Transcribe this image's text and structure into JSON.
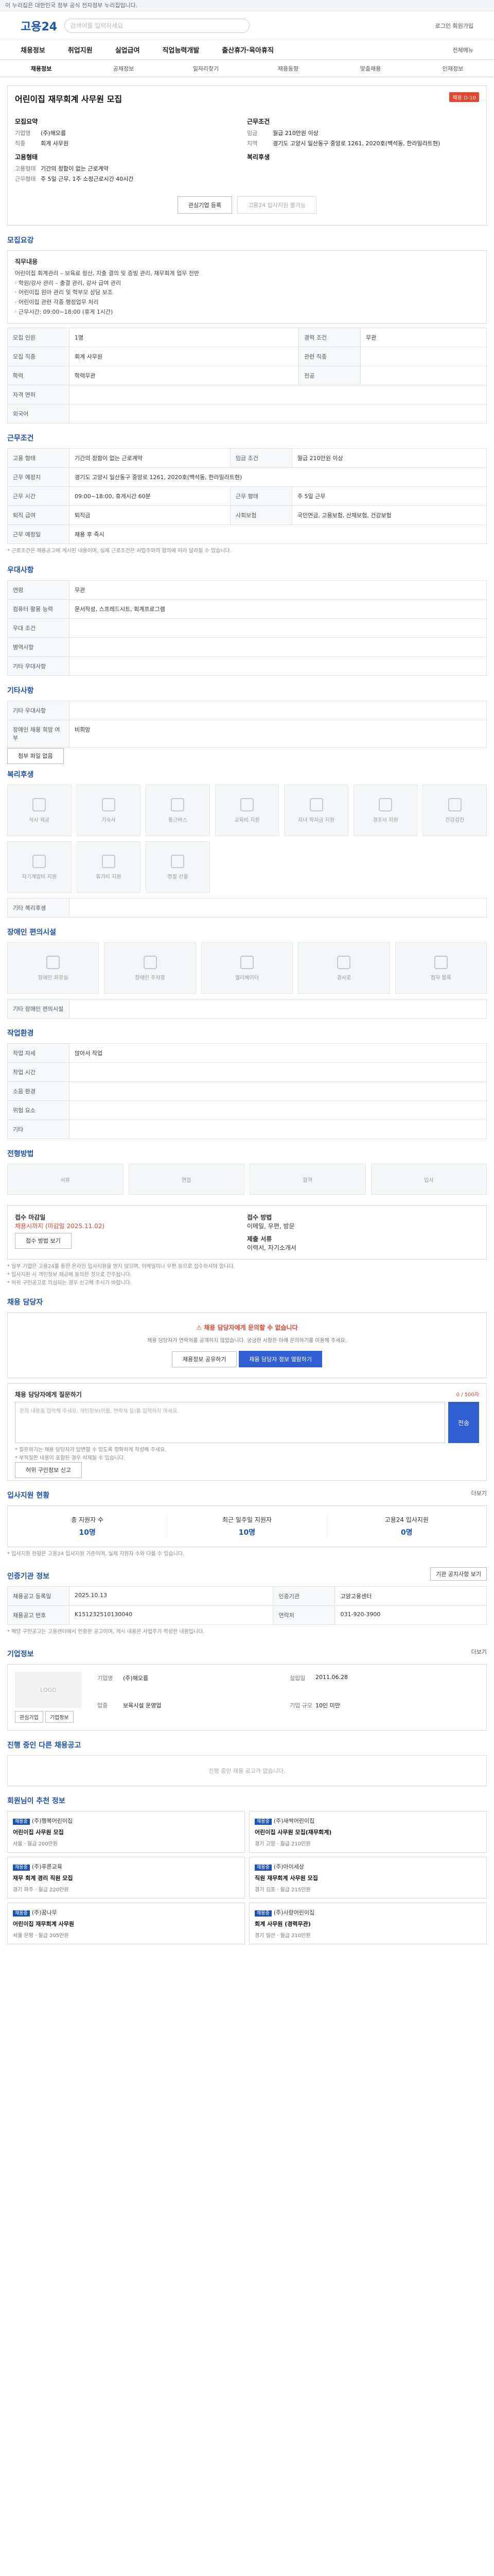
{
  "topbar": {
    "text": "이 누리집은 대한민국 정부 공식 전자정부 누리집입니다."
  },
  "header": {
    "logo": "고용24",
    "search_placeholder": "검색어를 입력하세요",
    "right_links": "로그인 회원가입"
  },
  "mainnav": [
    "채용정보",
    "취업지원",
    "실업급여",
    "직업능력개발",
    "출산휴가·육아휴직"
  ],
  "mainnav_right": "전체메뉴",
  "subnav": [
    "채용정보",
    "공채정보",
    "일자리찾기",
    "채용동향",
    "맞춤채용",
    "인재정보"
  ],
  "job": {
    "title": "어린이집 재무회계 사무원 모집",
    "badge": "채용 D-10",
    "company_header": "모집요약",
    "work_header": "근무조건",
    "employer_label": "기업명",
    "employer": "(주)해오름",
    "job_label": "직종",
    "job": "회계 사무원",
    "salary_label": "임금",
    "salary": "월급 210만원 이상",
    "location_label": "지역",
    "location": "경기도 고양시 일산동구 중앙로 1261, 2020호(백석동, 한라밀라트현)",
    "employment_header": "고용형태",
    "employment_label1": "고용형태",
    "employment1": "기간의 정함이 없는 근로계약",
    "employment_label2": "근무형태",
    "employment2": "주 5일 근무, 1주 소정근로시간 40시간",
    "welfare_header": "복리후생",
    "btn_interest": "관심기업 등록",
    "btn_apply": "고용24 입사지원 불가능"
  },
  "recruit": {
    "title": "모집요강",
    "duty_label": "직무내용",
    "duty_text": "어린이집 회계관리 – 보육료 정산, 지출 결의 및 증빙 관리, 재무회계 업무 전반\n· 학원/강사 관리 – 출결 관리, 강사 급여 관리\n· 어린이집 원아 관리 및 학부모 상담 보조\n· 어린이집 관련 각종 행정업무 처리\n· 근무시간: 09:00~18:00 (휴게 1시간)",
    "rows": [
      {
        "k": "모집 인원",
        "v": "1명",
        "k2": "경력 조건",
        "v2": "무관"
      },
      {
        "k": "모집 직종",
        "v": "회계 사무원",
        "k2": "관련 직종",
        "v2": ""
      },
      {
        "k": "학력",
        "v": "학력무관",
        "k2": "전공",
        "v2": ""
      },
      {
        "k": "자격 면허",
        "v": "",
        "k2": "",
        "v2": ""
      },
      {
        "k": "외국어",
        "v": "",
        "k2": "",
        "v2": ""
      }
    ]
  },
  "work": {
    "title": "근무조건",
    "rows": [
      {
        "k": "고용 형태",
        "v": "기간의 정함이 없는 근로계약",
        "k2": "임금 조건",
        "v2": "월급 210만원 이상"
      },
      {
        "k": "근무 예정지",
        "v": "경기도 고양시 일산동구 중앙로 1261, 2020호(백석동, 한라밀라트현)",
        "k2": "",
        "v2": ""
      },
      {
        "k": "근무 시간",
        "v": "09:00~18:00, 휴게시간 60분",
        "k2": "근무 형태",
        "v2": "주 5일 근무"
      },
      {
        "k": "퇴직 급여",
        "v": "퇴직금",
        "k2": "사회보험",
        "v2": "국민연금, 고용보험, 산재보험, 건강보험"
      },
      {
        "k": "근무 예정일",
        "v": "채용 후 즉시",
        "k2": "",
        "v2": ""
      }
    ],
    "note": "* 근로조건은 채용공고에 게시된 내용이며, 실제 근로조건은 사업주와의 협의에 따라 달라질 수 있습니다."
  },
  "conditions": {
    "title": "우대사항",
    "rows": [
      {
        "k": "연령",
        "v": "무관"
      },
      {
        "k": "컴퓨터 활용 능력",
        "v": "문서작성, 스프레드시트, 회계프로그램"
      },
      {
        "k": "우대 조건",
        "v": ""
      },
      {
        "k": "병역사항",
        "v": ""
      },
      {
        "k": "기타 우대사항",
        "v": ""
      }
    ]
  },
  "other": {
    "title": "기타사항",
    "rows": [
      {
        "k": "기타 우대사항",
        "v": ""
      },
      {
        "k": "장애인 채용 희망 여부",
        "v": "비희망"
      }
    ],
    "btn": "첨부 파일 없음"
  },
  "welfare": {
    "title": "복리후생",
    "items": [
      "식사 제공",
      "기숙사",
      "통근버스",
      "교육비 지원",
      "자녀 학자금 지원",
      "경조사 지원",
      "건강검진",
      "자기계발비 지원",
      "휴가비 지원",
      "명절 선물"
    ],
    "note": "기타 복리후생"
  },
  "disability": {
    "title": "장애인 편의시설",
    "items": [
      "장애인 화장실",
      "장애인 주차장",
      "엘리베이터",
      "경사로",
      "점자 블록"
    ],
    "note": "기타 장애인 편의시설"
  },
  "env": {
    "title": "작업환경",
    "rows": [
      {
        "k": "작업 자세",
        "v": "앉아서 작업",
        "k2": "",
        "v2": ""
      },
      {
        "k": "작업 시간",
        "v": "",
        "k2": "",
        "v2": ""
      },
      {
        "k": "소음 환경",
        "v": "",
        "k2": "",
        "v2": ""
      },
      {
        "k": "위험 요소",
        "v": "",
        "k2": "",
        "v2": ""
      },
      {
        "k": "기타",
        "v": "",
        "k2": "",
        "v2": ""
      }
    ]
  },
  "method": {
    "title": "전형방법",
    "steps": [
      "서류",
      "면접",
      "합격",
      "입사"
    ]
  },
  "apply": {
    "deadline_label": "접수 마감일",
    "deadline": "채용시까지 (마감일 2025.11.02)",
    "method_label": "접수 방법",
    "method": "이메일, 우편, 방문",
    "doc_label": "제출 서류",
    "doc": "이력서, 자기소개서",
    "btn": "접수 방법 보기",
    "note": "* 일부 기업은 고용24를 통한 온라인 입사지원을 받지 않으며, 이메일이나 우편 등으로 접수하셔야 합니다.\n* 입사지원 시 개인정보 제공에 동의한 것으로 간주됩니다.\n* 허위 구인공고로 의심되는 경우 신고해 주시기 바랍니다."
  },
  "contact": {
    "title": "채용 담당자",
    "alert": "채용 담당자에게 문의할 수 없습니다",
    "alert_sub": "채용 담당자가 연락처를 공개하지 않았습니다. 궁금한 사항은 아래 문의하기를 이용해 주세요.",
    "btn1": "채용정보 공유하기",
    "btn2": "채용 담당자 정보 열람하기",
    "inquiry_title": "채용 담당자에게 질문하기",
    "inquiry_note": "0 / 500자",
    "inquiry_placeholder": "문의 내용을 입력해 주세요. 개인정보(이름, 연락처 등)를 입력하지 마세요.",
    "submit": "전송",
    "tips": "* 질문하기는 채용 담당자가 답변할 수 있도록 정확하게 작성해 주세요.\n* 부적절한 내용이 포함된 경우 삭제될 수 있습니다.",
    "report_btn": "허위 구인정보 신고"
  },
  "stats": {
    "title": "입사지원 현황",
    "more": "더보기",
    "items": [
      {
        "label": "총 지원자 수",
        "value": "10명"
      },
      {
        "label": "최근 일주일 지원자",
        "value": "10명"
      },
      {
        "label": "고용24 입사지원",
        "value": "0명"
      }
    ],
    "note": "* 입사지원 현황은 고용24 입사지원 기준이며, 실제 지원자 수와 다를 수 있습니다."
  },
  "info": {
    "title": "인증기관 정보",
    "btn": "기관 공지사항 보기",
    "rows": [
      {
        "k": "채용공고 등록일",
        "v": "2025.10.13",
        "k2": "인증기관",
        "v2": "고양고용센터"
      },
      {
        "k": "채용공고 번호",
        "v": "K151232510130040",
        "k2": "연락처",
        "v2": "031-920-3900"
      }
    ],
    "note": "* 해당 구인공고는 고용센터에서 인증한 공고이며, 게시 내용은 사업주가 작성한 내용입니다."
  },
  "company": {
    "title": "기업정보",
    "more": "더보기",
    "logo_text": "LOGO",
    "rows": [
      {
        "k": "기업명",
        "v": "(주)해오름"
      },
      {
        "k": "업종",
        "v": "보육시설 운영업"
      },
      {
        "k": "기업 규모",
        "v": "10인 미만"
      },
      {
        "k": "설립일",
        "v": "2011.06.28"
      }
    ],
    "btn1": "관심기업",
    "btn2": "기업정보"
  },
  "other_jobs": {
    "title": "진행 중인 다른 채용공고",
    "empty": "진행 중인 채용 공고가 없습니다."
  },
  "recommend": {
    "title": "회원님이 추천 정보",
    "items": [
      {
        "tag": "채용중",
        "company": "(주)행복어린이집",
        "title": "어린이집 사무원 모집",
        "meta": "서울 · 월급 200만원"
      },
      {
        "tag": "채용중",
        "company": "(주)새싹어린이집",
        "title": "어린이집 사무원 모집(재무회계)",
        "meta": "경기 고양 · 월급 210만원"
      },
      {
        "tag": "채용중",
        "company": "(주)푸른교육",
        "title": "재무 회계 경리 직원 모집",
        "meta": "경기 파주 · 월급 220만원"
      },
      {
        "tag": "채용중",
        "company": "(주)아이세상",
        "title": "직원 재무회계 사무원 모집",
        "meta": "경기 김포 · 월급 215만원"
      },
      {
        "tag": "채용중",
        "company": "(주)꿈나무",
        "title": "어린이집 재무회계 사무원",
        "meta": "서울 은평 · 월급 205만원"
      },
      {
        "tag": "채용중",
        "company": "(주)사랑어린이집",
        "title": "회계 사무원 (경력무관)",
        "meta": "경기 일산 · 월급 210만원"
      }
    ]
  }
}
